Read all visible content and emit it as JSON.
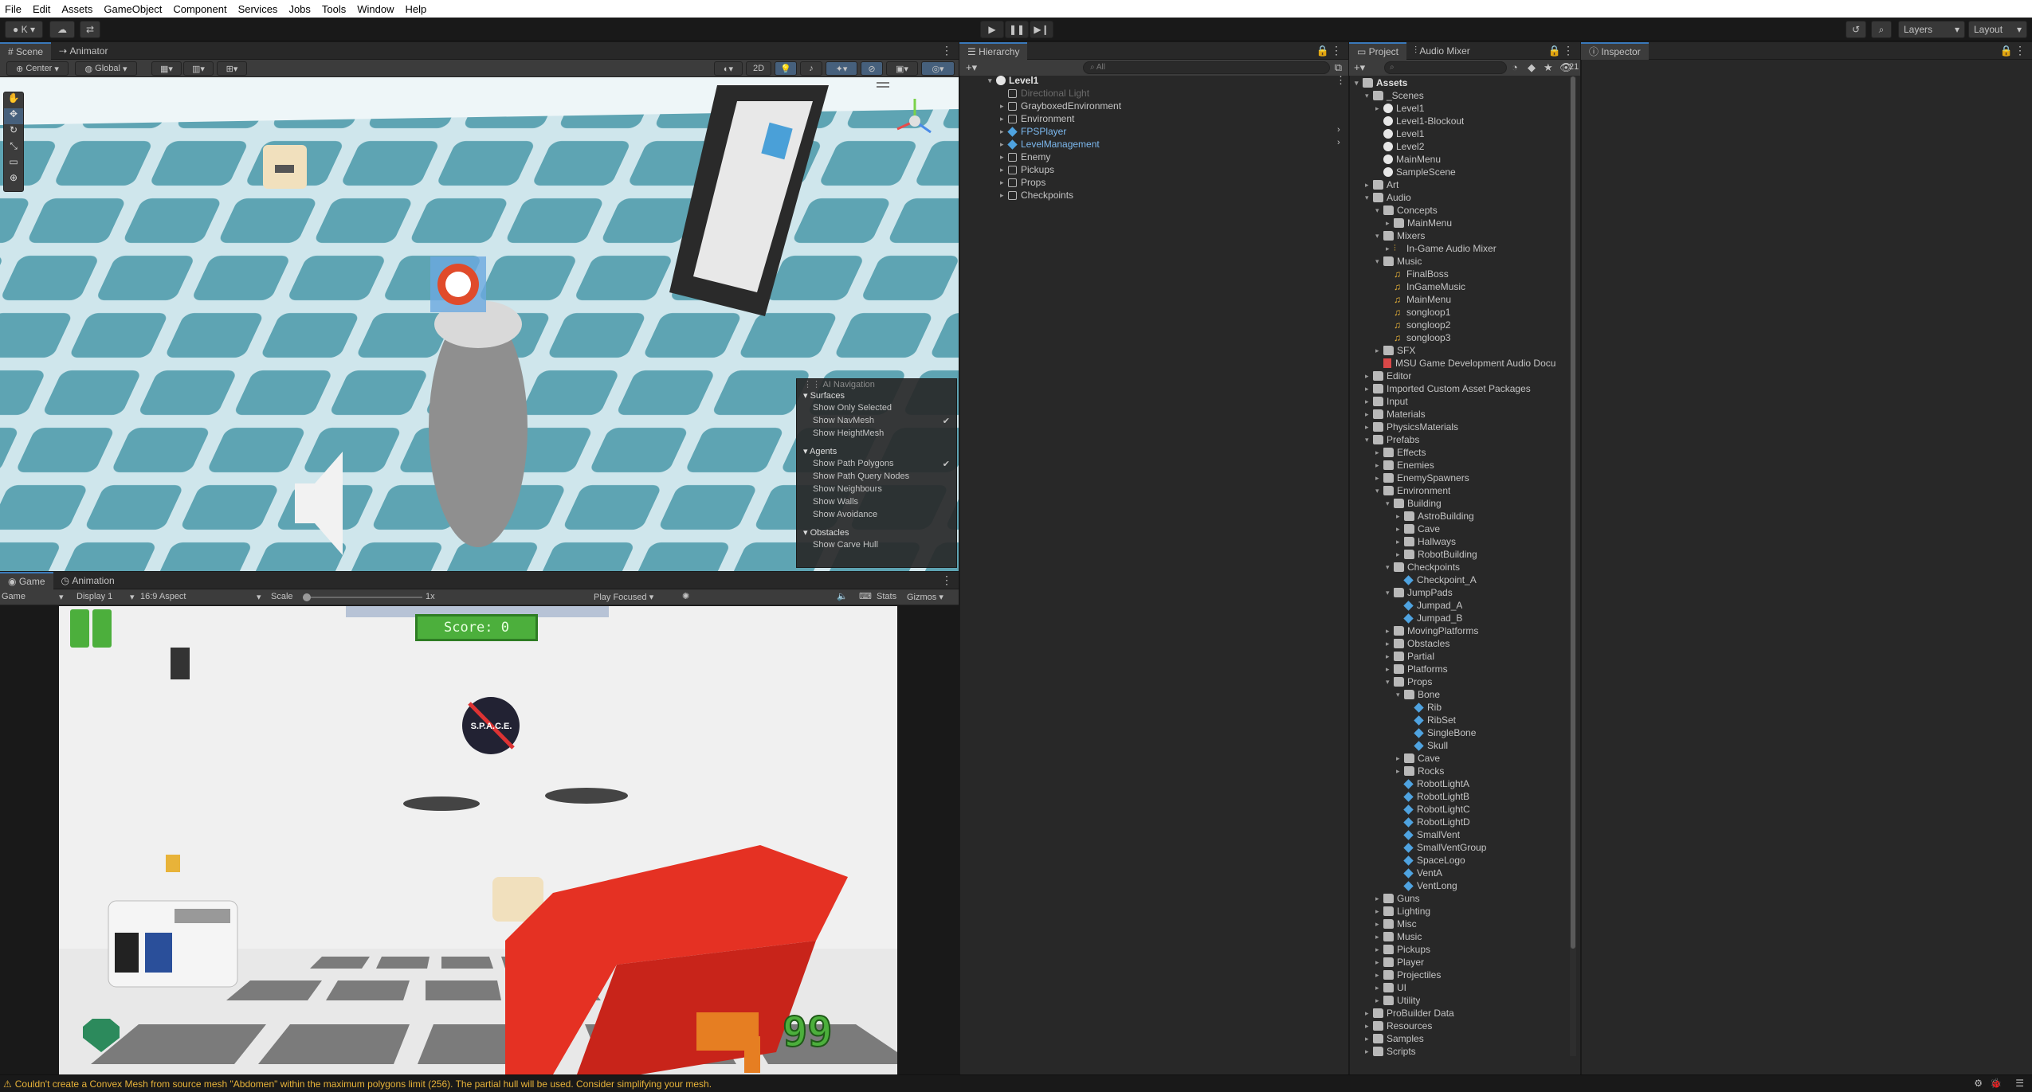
{
  "menu": [
    "File",
    "Edit",
    "Assets",
    "GameObject",
    "Component",
    "Services",
    "Jobs",
    "Tools",
    "Window",
    "Help"
  ],
  "toolbar": {
    "account": "K",
    "layers": "Layers",
    "layout": "Layout"
  },
  "scene_panel": {
    "tabs": [
      "Scene",
      "Animator"
    ],
    "pivot": "Center",
    "space": "Global",
    "mode_2d": "2D",
    "ai_nav": {
      "title": "AI Navigation",
      "surfaces": "Surfaces",
      "show_only_selected": "Show Only Selected",
      "show_navmesh": "Show NavMesh",
      "show_heightmesh": "Show HeightMesh",
      "agents": "Agents",
      "show_path_polygons": "Show Path Polygons",
      "show_path_query_nodes": "Show Path Query Nodes",
      "show_neighbours": "Show Neighbours",
      "show_walls": "Show Walls",
      "show_avoidance": "Show Avoidance",
      "obstacles": "Obstacles",
      "show_carve_hull": "Show Carve Hull"
    }
  },
  "game_panel": {
    "tabs": [
      "Game",
      "Animation"
    ],
    "mode": "Game",
    "display": "Display 1",
    "aspect": "16:9 Aspect",
    "scale_label": "Scale",
    "scale_value": "1x",
    "play_focused": "Play Focused",
    "stats": "Stats",
    "gizmos": "Gizmos",
    "score": "Score: 0",
    "ammo": "99",
    "logo_text": "S.P.A.C.E."
  },
  "hierarchy": {
    "tab": "Hierarchy",
    "search_placeholder": "All",
    "root": "Level1",
    "items": [
      "Directional Light",
      "GrayboxedEnvironment",
      "Environment",
      "FPSPlayer",
      "LevelManagement",
      "Enemy",
      "Pickups",
      "Props",
      "Checkpoints"
    ]
  },
  "project": {
    "tabs": [
      "Project",
      "Audio Mixer"
    ],
    "count": "21",
    "root": "Assets",
    "tree": [
      {
        "d": 1,
        "t": "folder",
        "open": true,
        "n": "_Scenes"
      },
      {
        "d": 2,
        "t": "scene",
        "arrow": true,
        "n": "Level1"
      },
      {
        "d": 2,
        "t": "scene",
        "n": "Level1-Blockout"
      },
      {
        "d": 2,
        "t": "scene",
        "n": "Level1"
      },
      {
        "d": 2,
        "t": "scene",
        "n": "Level2"
      },
      {
        "d": 2,
        "t": "scene",
        "n": "MainMenu"
      },
      {
        "d": 2,
        "t": "scene",
        "n": "SampleScene"
      },
      {
        "d": 1,
        "t": "folder",
        "arrow": true,
        "n": "Art"
      },
      {
        "d": 1,
        "t": "folder",
        "open": true,
        "n": "Audio"
      },
      {
        "d": 2,
        "t": "folder",
        "open": true,
        "n": "Concepts"
      },
      {
        "d": 3,
        "t": "folder",
        "arrow": true,
        "n": "MainMenu"
      },
      {
        "d": 2,
        "t": "folder",
        "open": true,
        "n": "Mixers"
      },
      {
        "d": 3,
        "t": "mixer",
        "arrow": true,
        "n": "In-Game Audio Mixer"
      },
      {
        "d": 2,
        "t": "folder",
        "open": true,
        "n": "Music"
      },
      {
        "d": 3,
        "t": "audio",
        "n": "FinalBoss"
      },
      {
        "d": 3,
        "t": "audio",
        "n": "InGameMusic"
      },
      {
        "d": 3,
        "t": "audio",
        "n": "MainMenu"
      },
      {
        "d": 3,
        "t": "audio",
        "n": "songloop1"
      },
      {
        "d": 3,
        "t": "audio",
        "n": "songloop2"
      },
      {
        "d": 3,
        "t": "audio",
        "n": "songloop3"
      },
      {
        "d": 2,
        "t": "folder",
        "arrow": true,
        "n": "SFX"
      },
      {
        "d": 2,
        "t": "pdf",
        "n": "MSU Game Development Audio Docu"
      },
      {
        "d": 1,
        "t": "folder",
        "arrow": true,
        "n": "Editor"
      },
      {
        "d": 1,
        "t": "folder",
        "arrow": true,
        "n": "Imported Custom Asset Packages"
      },
      {
        "d": 1,
        "t": "folder",
        "arrow": true,
        "n": "Input"
      },
      {
        "d": 1,
        "t": "folder",
        "arrow": true,
        "n": "Materials"
      },
      {
        "d": 1,
        "t": "folder",
        "arrow": true,
        "n": "PhysicsMaterials"
      },
      {
        "d": 1,
        "t": "folder",
        "open": true,
        "n": "Prefabs"
      },
      {
        "d": 2,
        "t": "folder",
        "arrow": true,
        "n": "Effects"
      },
      {
        "d": 2,
        "t": "folder",
        "arrow": true,
        "n": "Enemies"
      },
      {
        "d": 2,
        "t": "folder",
        "arrow": true,
        "n": "EnemySpawners"
      },
      {
        "d": 2,
        "t": "folder",
        "open": true,
        "n": "Environment"
      },
      {
        "d": 3,
        "t": "folder",
        "open": true,
        "n": "Building"
      },
      {
        "d": 4,
        "t": "folder",
        "arrow": true,
        "n": "AstroBuilding"
      },
      {
        "d": 4,
        "t": "folder",
        "arrow": true,
        "n": "Cave"
      },
      {
        "d": 4,
        "t": "folder",
        "arrow": true,
        "n": "Hallways"
      },
      {
        "d": 4,
        "t": "folder",
        "arrow": true,
        "n": "RobotBuilding"
      },
      {
        "d": 3,
        "t": "folder",
        "open": true,
        "n": "Checkpoints"
      },
      {
        "d": 4,
        "t": "prefab",
        "n": "Checkpoint_A"
      },
      {
        "d": 3,
        "t": "folder",
        "open": true,
        "n": "JumpPads"
      },
      {
        "d": 4,
        "t": "prefab",
        "n": "Jumpad_A"
      },
      {
        "d": 4,
        "t": "prefab",
        "n": "Jumpad_B"
      },
      {
        "d": 3,
        "t": "folder",
        "arrow": true,
        "n": "MovingPlatforms"
      },
      {
        "d": 3,
        "t": "folder",
        "arrow": true,
        "n": "Obstacles"
      },
      {
        "d": 3,
        "t": "folder",
        "arrow": true,
        "n": "Partial"
      },
      {
        "d": 3,
        "t": "folder",
        "arrow": true,
        "n": "Platforms"
      },
      {
        "d": 3,
        "t": "folder",
        "open": true,
        "n": "Props"
      },
      {
        "d": 4,
        "t": "folder",
        "open": true,
        "n": "Bone"
      },
      {
        "d": 5,
        "t": "prefab",
        "n": "Rib"
      },
      {
        "d": 5,
        "t": "prefab",
        "n": "RibSet"
      },
      {
        "d": 5,
        "t": "prefab",
        "n": "SingleBone"
      },
      {
        "d": 5,
        "t": "prefab",
        "n": "Skull"
      },
      {
        "d": 4,
        "t": "folder",
        "arrow": true,
        "n": "Cave"
      },
      {
        "d": 4,
        "t": "folder",
        "arrow": true,
        "n": "Rocks"
      },
      {
        "d": 4,
        "t": "prefab",
        "n": "RobotLightA"
      },
      {
        "d": 4,
        "t": "prefab",
        "n": "RobotLightB"
      },
      {
        "d": 4,
        "t": "prefab",
        "n": "RobotLightC"
      },
      {
        "d": 4,
        "t": "prefab",
        "n": "RobotLightD"
      },
      {
        "d": 4,
        "t": "prefab",
        "n": "SmallVent"
      },
      {
        "d": 4,
        "t": "prefab",
        "n": "SmallVentGroup"
      },
      {
        "d": 4,
        "t": "prefab",
        "n": "SpaceLogo"
      },
      {
        "d": 4,
        "t": "prefab",
        "n": "VentA"
      },
      {
        "d": 4,
        "t": "prefab",
        "n": "VentLong"
      },
      {
        "d": 2,
        "t": "folder",
        "arrow": true,
        "n": "Guns"
      },
      {
        "d": 2,
        "t": "folder",
        "arrow": true,
        "n": "Lighting"
      },
      {
        "d": 2,
        "t": "folder",
        "arrow": true,
        "n": "Misc"
      },
      {
        "d": 2,
        "t": "folder",
        "arrow": true,
        "n": "Music"
      },
      {
        "d": 2,
        "t": "folder",
        "arrow": true,
        "n": "Pickups"
      },
      {
        "d": 2,
        "t": "folder",
        "arrow": true,
        "n": "Player"
      },
      {
        "d": 2,
        "t": "folder",
        "arrow": true,
        "n": "Projectiles"
      },
      {
        "d": 2,
        "t": "folder",
        "arrow": true,
        "n": "UI"
      },
      {
        "d": 2,
        "t": "folder",
        "arrow": true,
        "n": "Utility"
      },
      {
        "d": 1,
        "t": "folder",
        "arrow": true,
        "n": "ProBuilder Data"
      },
      {
        "d": 1,
        "t": "folder",
        "arrow": true,
        "n": "Resources"
      },
      {
        "d": 1,
        "t": "folder",
        "arrow": true,
        "n": "Samples"
      },
      {
        "d": 1,
        "t": "folder",
        "arrow": true,
        "n": "Scripts"
      }
    ]
  },
  "inspector": {
    "tab": "Inspector"
  },
  "status": {
    "message": "Couldn't create a Convex Mesh from source mesh \"Abdomen\" within the maximum polygons limit (256). The partial hull will be used. Consider simplifying your mesh."
  },
  "colors": {
    "accent": "#3a79bb",
    "prefab": "#4fa3e0",
    "warning": "#e8b339",
    "score_green": "#4caf3c"
  }
}
